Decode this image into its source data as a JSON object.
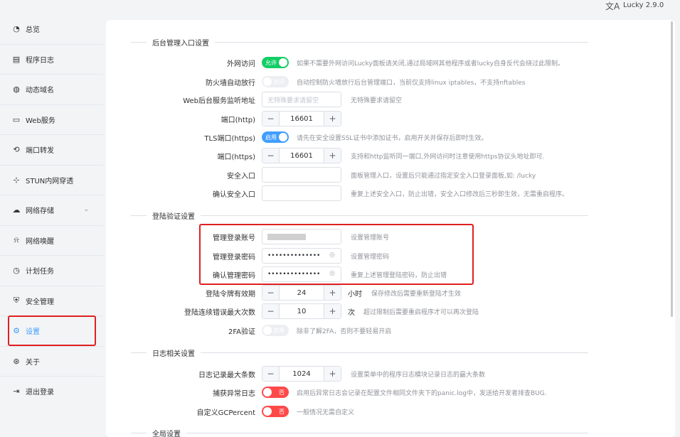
{
  "topbar": {
    "lang_icon": "translate-icon",
    "lang_glyph": "文A",
    "version": "Lucky 2.9.0"
  },
  "sidebar": {
    "items": [
      {
        "label": "总览",
        "icon": "dashboard-icon",
        "glyph": "◔"
      },
      {
        "label": "程序日志",
        "icon": "log-icon",
        "glyph": "▤"
      },
      {
        "label": "动态域名",
        "icon": "ddns-icon",
        "glyph": "◍"
      },
      {
        "label": "Web服务",
        "icon": "web-service-icon",
        "glyph": "▭"
      },
      {
        "label": "端口转发",
        "icon": "port-forward-icon",
        "glyph": "⟲"
      },
      {
        "label": "STUN内网穿透",
        "icon": "stun-icon",
        "glyph": "⊹"
      },
      {
        "label": "网络存储",
        "icon": "cloud-storage-icon",
        "glyph": "☁"
      },
      {
        "label": "网络唤醒",
        "icon": "bell-icon",
        "glyph": "⍾"
      },
      {
        "label": "计划任务",
        "icon": "clock-icon",
        "glyph": "◷"
      },
      {
        "label": "安全管理",
        "icon": "shield-icon",
        "glyph": "⛨"
      },
      {
        "label": "设置",
        "icon": "gear-icon",
        "glyph": "⚙"
      },
      {
        "label": "关于",
        "icon": "about-icon",
        "glyph": "⊛"
      },
      {
        "label": "退出登录",
        "icon": "logout-icon",
        "glyph": "⇥"
      }
    ],
    "caret": "⌄"
  },
  "main": {
    "section_admin": "后台管理入口设置",
    "external_access": {
      "label": "外网访问",
      "switch": "允许",
      "hint": "如果不需要外网访问Lucky面板请关闭,通过局域网其他程序或者lucky自身反代会绕过此限制。"
    },
    "firewall": {
      "label": "防火墙自动放行",
      "switch": "关闭",
      "hint": "自动控制防火墙放行后台管理端口，当前仅支持linux iptables，不支持nftables"
    },
    "listen_addr": {
      "label": "Web后台服务监听地址",
      "placeholder": "无特殊要求请留空",
      "hint": "无特殊要求请留空"
    },
    "http_port": {
      "label": "端口(http)",
      "value": "16601",
      "minus": "−",
      "plus": "+"
    },
    "tls_port_switch": {
      "label": "TLS端口(https)",
      "switch": "启用",
      "hint": "请先在安全设置SSL证书中添加证书，启用开关并保存后即时生效。"
    },
    "https_port": {
      "label": "端口(https)",
      "value": "16601",
      "minus": "−",
      "plus": "+",
      "hint": "支持和http监听同一端口,外网访问时注意使用https协议头地址即可."
    },
    "safe_entry": {
      "label": "安全入口",
      "hint": "面板管理入口，设置后只能通过指定安全入口登录面板,如: /lucky"
    },
    "confirm_safe_entry": {
      "label": "确认安全入口",
      "hint": "重复上述安全入口，防止出错，安全入口修改后三秒即生效，无需重启程序。"
    },
    "section_auth": "登陆验证设置",
    "admin_account": {
      "label": "管理登录账号",
      "hint": "设置管理账号"
    },
    "admin_password": {
      "label": "管理登录密码",
      "value": "••••••••••••••",
      "eye": "◎",
      "hint": "设置管理密码"
    },
    "confirm_password": {
      "label": "确认管理密码",
      "value": "••••••••••••••",
      "eye": "◎",
      "hint": "重复上述管理登陆密码，防止出错"
    },
    "token_valid": {
      "label": "登陆令牌有效期",
      "value": "24",
      "minus": "−",
      "plus": "+",
      "unit": "小时",
      "hint": "保存修改后需要重新登陆才生效"
    },
    "max_errors": {
      "label": "登陆连续错误最大次数",
      "value": "10",
      "minus": "−",
      "plus": "+",
      "unit": "次",
      "hint": "超过限制后需要重启程序才可以再次登陆"
    },
    "twofa": {
      "label": "2FA验证",
      "switch": "禁用",
      "hint": "除非了解2FA，否则不要轻易开启"
    },
    "section_log": "日志相关设置",
    "log_max": {
      "label": "日志记录最大条数",
      "value": "1024",
      "minus": "−",
      "plus": "+",
      "hint": "设置菜单中的程序日志模块记录日志的最大条数"
    },
    "panic_log": {
      "label": "捕获异常日志",
      "switch": "否",
      "hint": "启用后异常日志会记录在配置文件相同文件夹下的panic.log中，发送给开发者排查BUG."
    },
    "gc_percent": {
      "label": "自定义GCPercent",
      "switch": "否",
      "hint": "一般情况无需自定义"
    },
    "section_global": "全局设置"
  }
}
